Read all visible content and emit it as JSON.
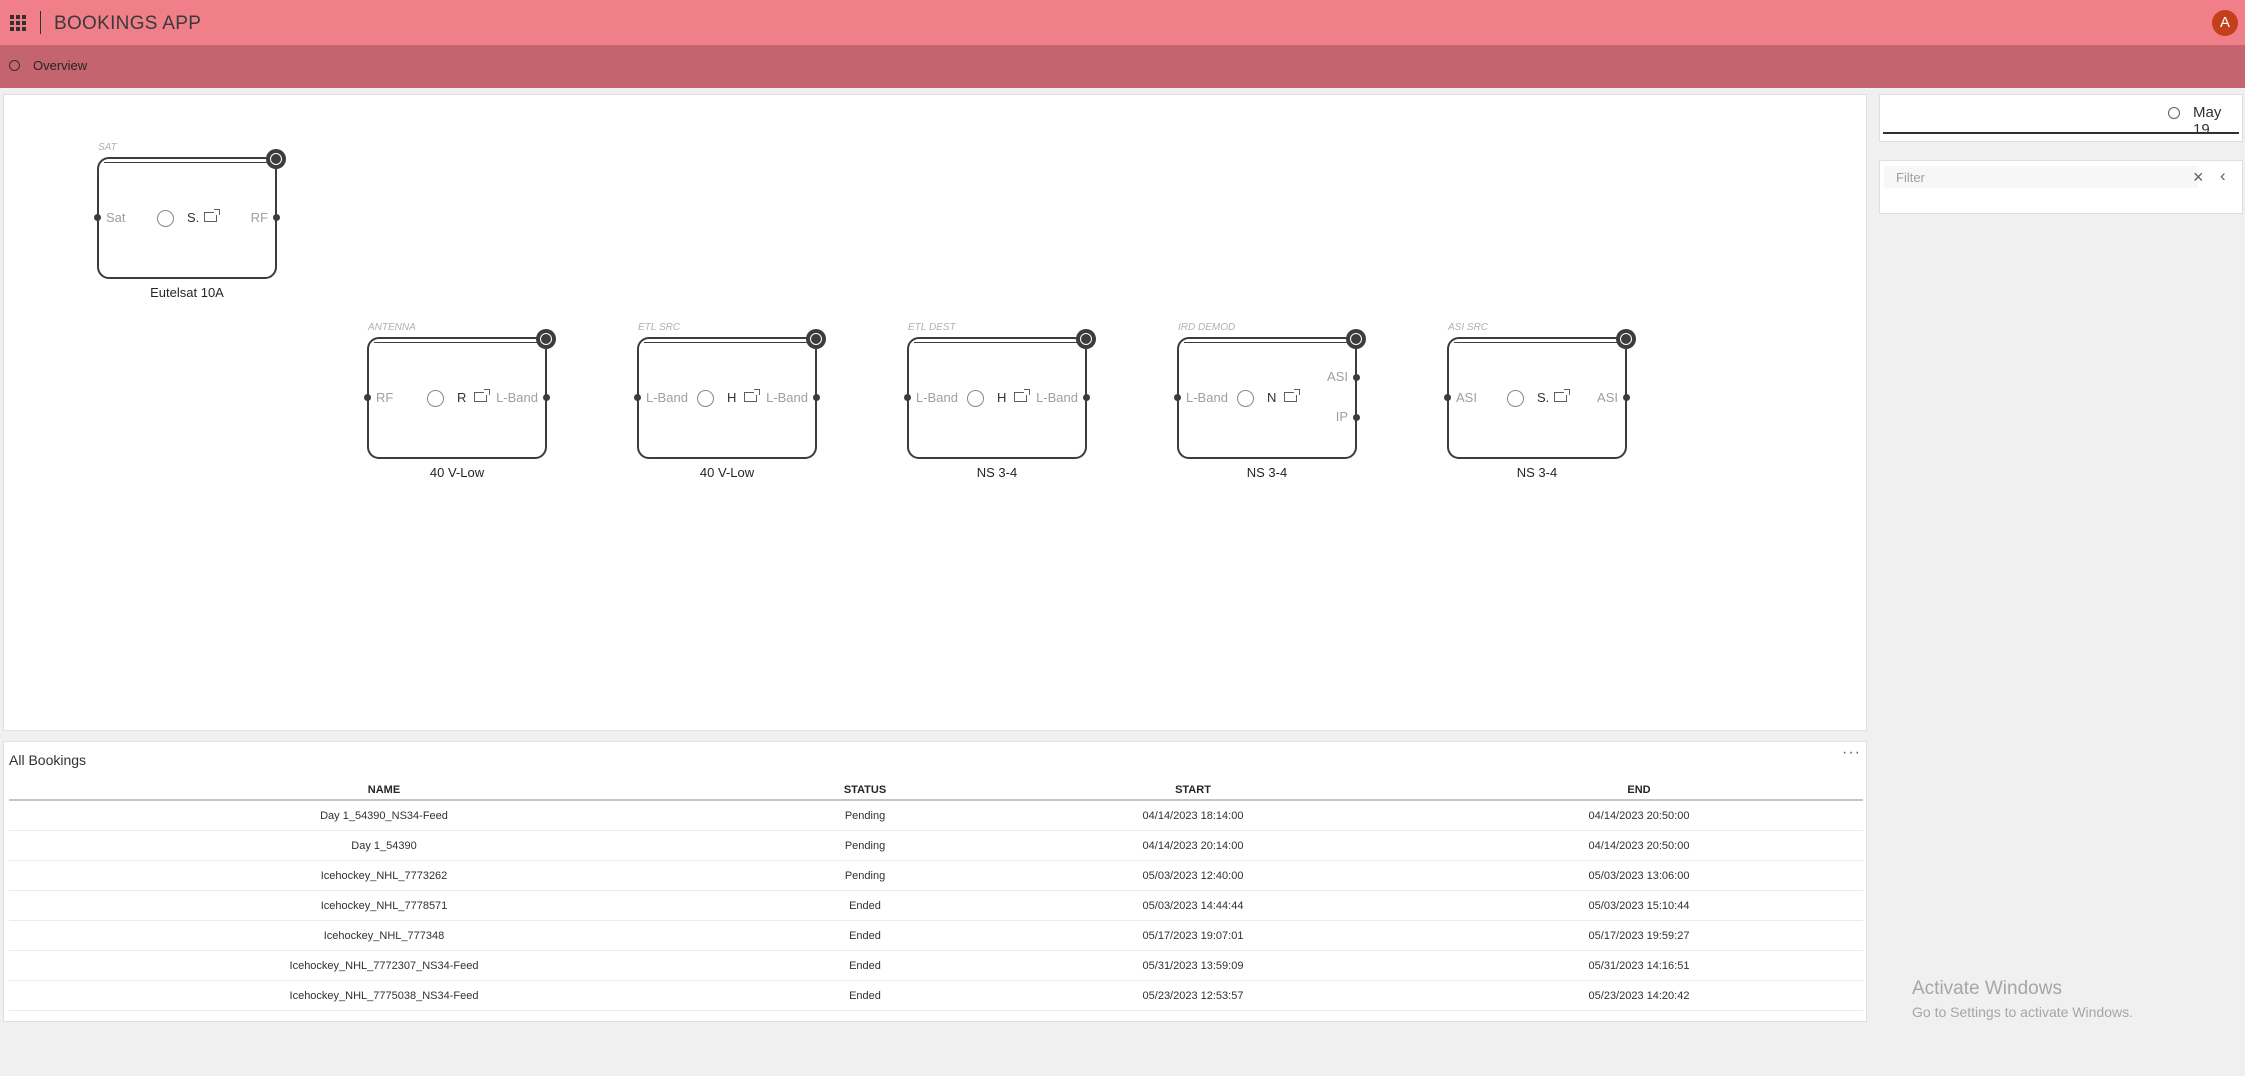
{
  "header": {
    "app_title": "BOOKINGS APP",
    "avatar_initial": "A"
  },
  "nav": {
    "overview_label": "Overview"
  },
  "diagram": {
    "nodes": [
      {
        "type": "SAT",
        "name": "Eutelsat 10A",
        "port_left": "Sat",
        "port_right": "RF",
        "port_right_2": "",
        "mid": "S."
      },
      {
        "type": "ANTENNA",
        "name": "40 V-Low",
        "port_left": "RF",
        "port_right": "L-Band",
        "port_right_2": "",
        "mid": "R"
      },
      {
        "type": "ETL SRC",
        "name": "40 V-Low",
        "port_left": "L-Band",
        "port_right": "L-Band",
        "port_right_2": "",
        "mid": "H"
      },
      {
        "type": "ETL DEST",
        "name": "NS 3-4",
        "port_left": "L-Band",
        "port_right": "L-Band",
        "port_right_2": "",
        "mid": "H"
      },
      {
        "type": "IRD DEMOD",
        "name": "NS 3-4",
        "port_left": "L-Band",
        "port_right": "ASI",
        "port_right_2": "IP",
        "mid": "N"
      },
      {
        "type": "ASI SRC",
        "name": "NS 3-4",
        "port_left": "ASI",
        "port_right": "ASI",
        "port_right_2": "",
        "mid": "S."
      }
    ]
  },
  "sidepanel": {
    "date_label": "May 19",
    "filter_placeholder": "Filter"
  },
  "bookings": {
    "title": "All Bookings",
    "more_label": "···",
    "headers": {
      "name": "NAME",
      "status": "STATUS",
      "start": "START",
      "end": "END"
    },
    "rows": [
      {
        "name": "Day 1_54390_NS34-Feed",
        "status": "Pending",
        "start": "04/14/2023 18:14:00",
        "end": "04/14/2023 20:50:00"
      },
      {
        "name": "Day 1_54390",
        "status": "Pending",
        "start": "04/14/2023 20:14:00",
        "end": "04/14/2023 20:50:00"
      },
      {
        "name": "Icehockey_NHL_7773262",
        "status": "Pending",
        "start": "05/03/2023 12:40:00",
        "end": "05/03/2023 13:06:00"
      },
      {
        "name": "Icehockey_NHL_7778571",
        "status": "Ended",
        "start": "05/03/2023 14:44:44",
        "end": "05/03/2023 15:10:44"
      },
      {
        "name": "Icehockey_NHL_777348",
        "status": "Ended",
        "start": "05/17/2023 19:07:01",
        "end": "05/17/2023 19:59:27"
      },
      {
        "name": "Icehockey_NHL_7772307_NS34-Feed",
        "status": "Ended",
        "start": "05/31/2023 13:59:09",
        "end": "05/31/2023 14:16:51"
      },
      {
        "name": "Icehockey_NHL_7775038_NS34-Feed",
        "status": "Ended",
        "start": "05/23/2023 12:53:57",
        "end": "05/23/2023 14:20:42"
      }
    ]
  },
  "watermark": {
    "line1": "Activate Windows",
    "line2": "Go to Settings to activate Windows."
  },
  "colors": {
    "topbar": "#f17f8a",
    "navbar": "#c4646f",
    "avatar": "#c4401a"
  },
  "icons": {
    "app_launcher": "waffle-icon",
    "nav": "circle-icon",
    "clock": "clock-icon",
    "clear": "close-icon",
    "collapse": "chevron-left-icon",
    "info": "info-icon",
    "open": "open-external-icon"
  }
}
